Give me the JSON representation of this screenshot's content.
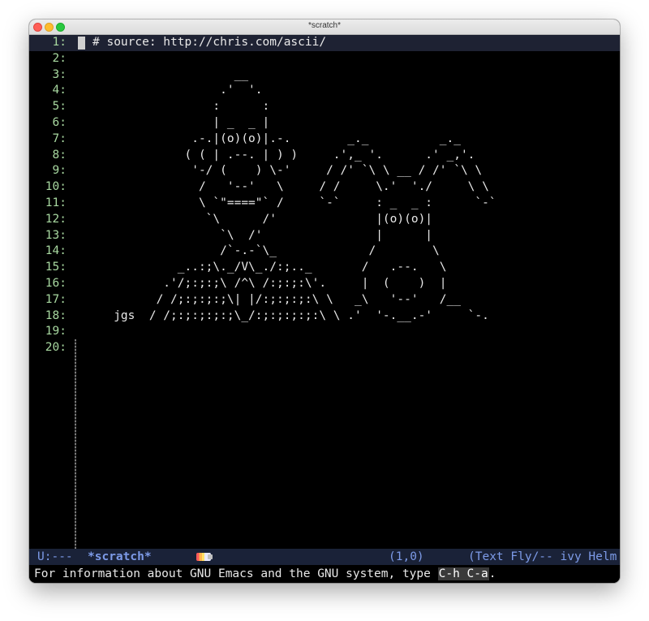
{
  "window": {
    "title": "*scratch*"
  },
  "buffer": {
    "lines": [
      {
        "num": "1:",
        "text": "# source: http://chris.com/ascii/"
      },
      {
        "num": "2:",
        "text": ""
      },
      {
        "num": "3:",
        "text": "                    __"
      },
      {
        "num": "4:",
        "text": "                  .'  '."
      },
      {
        "num": "5:",
        "text": "                 :      :"
      },
      {
        "num": "6:",
        "text": "                 | _  _ |"
      },
      {
        "num": "7:",
        "text": "              .-.|(o)(o)|.-.        _._          _._"
      },
      {
        "num": "8:",
        "text": "             ( ( | .--. | ) )     .',_ '.      .' _,'."
      },
      {
        "num": "9:",
        "text": "              '-/ (    ) \\-'     / /' `\\ \\ __ / /' `\\ \\"
      },
      {
        "num": "10:",
        "text": "               /   '--'   \\     / /     \\.'  './     \\ \\"
      },
      {
        "num": "11:",
        "text": "               \\ `\"====\"` /     `-`     : _  _ :      `-`"
      },
      {
        "num": "12:",
        "text": "                `\\      /'              |(o)(o)|"
      },
      {
        "num": "13:",
        "text": "                  `\\  /'                |      |"
      },
      {
        "num": "14:",
        "text": "                  /`-.-`\\_             /        \\"
      },
      {
        "num": "15:",
        "text": "            _..:;\\._/V\\_./:;.._       /   .--.   \\"
      },
      {
        "num": "16:",
        "text": "          .'/;:;:;\\ /^\\ /:;:;:\\'.     |  (    )  |"
      },
      {
        "num": "17:",
        "text": "         / /;:;:;:;\\| |/:;:;:;:\\ \\   _\\   '--'   /__"
      },
      {
        "num": "18:",
        "text": "   jgs  / /;:;:;:;:;\\_/:;:;:;:;:\\ \\ .'  '-.__.-'     `-."
      },
      {
        "num": "19:",
        "text": ""
      },
      {
        "num": "20:",
        "text": ""
      }
    ]
  },
  "modeline": {
    "status": "U:---",
    "buffer_name": "*scratch*",
    "position": "(1,0)",
    "modes": "(Text Fly/-- ivy Helm"
  },
  "echo_area": {
    "prefix": "For information about GNU Emacs and the GNU system, type ",
    "key": "C-h C-a",
    "suffix": "."
  }
}
